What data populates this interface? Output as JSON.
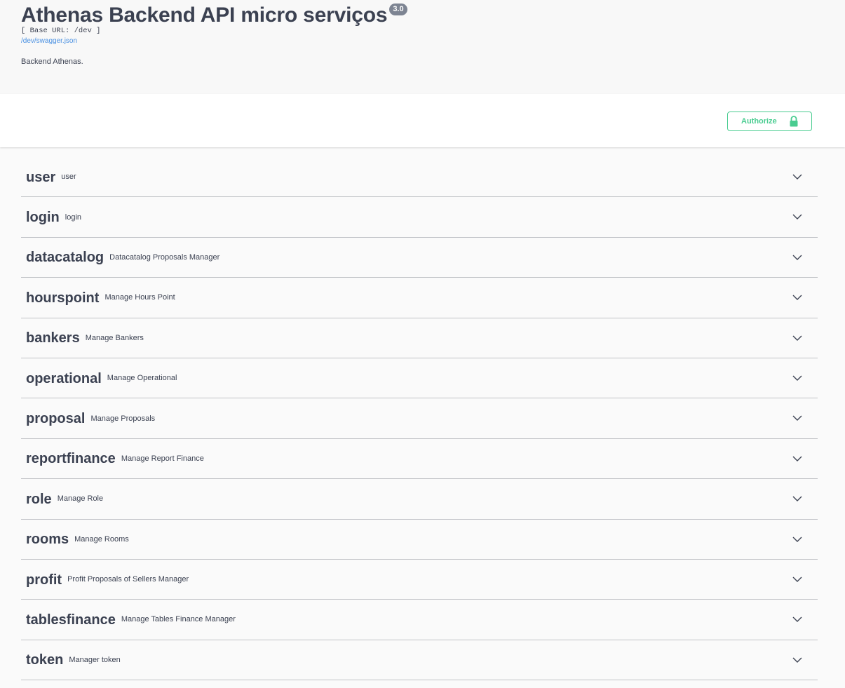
{
  "info": {
    "title": "Athenas Backend API micro serviços",
    "version": "3.0",
    "base_url": "[ Base URL: /dev ]",
    "spec_link": "/dev/swagger.json",
    "description": "Backend Athenas."
  },
  "scheme": {
    "authorize_label": "Authorize",
    "authorize_icon": "lock-icon"
  },
  "colors": {
    "accent_green": "#49cc90",
    "text": "#3b4151",
    "link": "#4990e2",
    "version_badge": "#7d8492"
  },
  "tags": [
    {
      "name": "user",
      "description": "user"
    },
    {
      "name": "login",
      "description": "login"
    },
    {
      "name": "datacatalog",
      "description": "Datacatalog Proposals Manager"
    },
    {
      "name": "hourspoint",
      "description": "Manage Hours Point"
    },
    {
      "name": "bankers",
      "description": "Manage Bankers"
    },
    {
      "name": "operational",
      "description": "Manage Operational"
    },
    {
      "name": "proposal",
      "description": "Manage Proposals"
    },
    {
      "name": "reportfinance",
      "description": "Manage Report Finance"
    },
    {
      "name": "role",
      "description": "Manage Role"
    },
    {
      "name": "rooms",
      "description": "Manage Rooms"
    },
    {
      "name": "profit",
      "description": "Profit Proposals of Sellers Manager"
    },
    {
      "name": "tablesfinance",
      "description": "Manage Tables Finance Manager"
    },
    {
      "name": "token",
      "description": "Manager token"
    }
  ]
}
